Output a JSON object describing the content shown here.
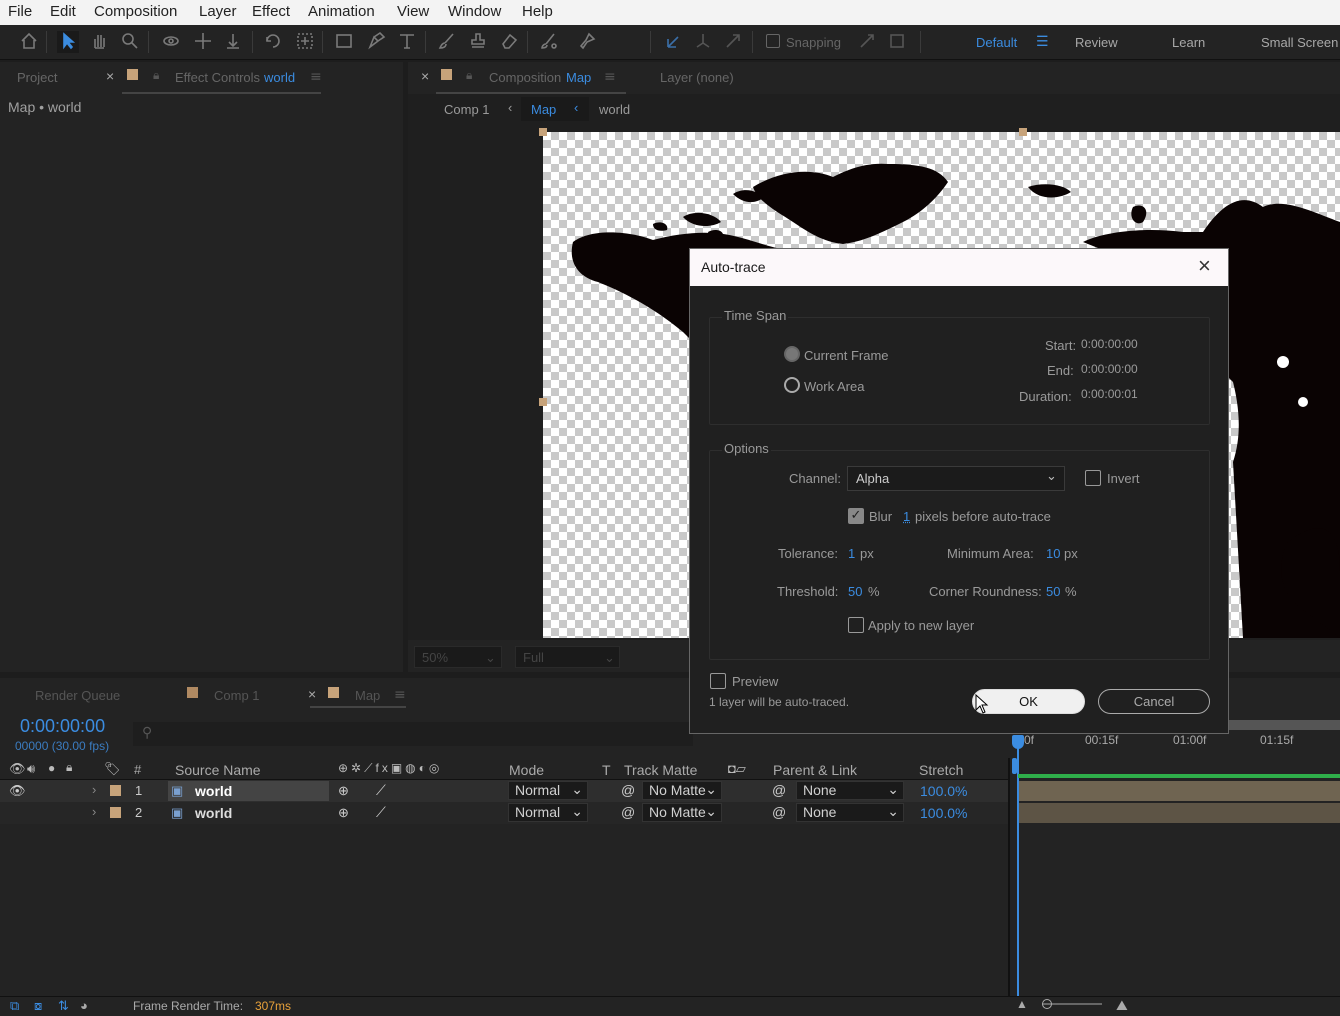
{
  "menu": [
    "File",
    "Edit",
    "Composition",
    "Layer",
    "Effect",
    "Animation",
    "View",
    "Window",
    "Help"
  ],
  "toolbar": {
    "snapping_label": "Snapping",
    "workspaces": [
      "Default",
      "Review",
      "Learn",
      "Small Screen"
    ]
  },
  "left_panel": {
    "tab_project": "Project",
    "tab_effect_controls": "Effect Controls",
    "effect_controls_target": "world",
    "breadcrumb": "Map • world"
  },
  "comp_panel": {
    "tab_label": "Composition",
    "tab_comp_name": "Map",
    "layer_tab": "Layer (none)",
    "crumbs": [
      "Comp 1",
      "Map",
      "world"
    ],
    "zoom": "50%",
    "resolution": "Full"
  },
  "dialog": {
    "title": "Auto-trace",
    "time_span_title": "Time Span",
    "current_frame": "Current Frame",
    "work_area": "Work Area",
    "start_label": "Start:",
    "start_value": "0:00:00:00",
    "end_label": "End:",
    "end_value": "0:00:00:00",
    "duration_label": "Duration:",
    "duration_value": "0:00:00:01",
    "options_title": "Options",
    "channel_label": "Channel:",
    "channel_value": "Alpha",
    "invert_label": "Invert",
    "blur_label": "Blur",
    "blur_value": "1",
    "blur_suffix": "pixels before auto-trace",
    "tolerance_label": "Tolerance:",
    "tolerance_value": "1",
    "tolerance_unit": "px",
    "min_area_label": "Minimum Area:",
    "min_area_value": "10",
    "min_area_unit": "px",
    "threshold_label": "Threshold:",
    "threshold_value": "50",
    "threshold_unit": "%",
    "corner_label": "Corner Roundness:",
    "corner_value": "50",
    "corner_unit": "%",
    "apply_new_layer": "Apply to new layer",
    "preview_label": "Preview",
    "status_text": "1 layer will be auto-traced.",
    "ok_label": "OK",
    "cancel_label": "Cancel"
  },
  "timeline": {
    "tab_render_queue": "Render Queue",
    "tab_comp1": "Comp 1",
    "tab_map": "Map",
    "timecode": "0:00:00:00",
    "frame_info": "00000 (30.00 fps)",
    "ruler": [
      "0f",
      "00:15f",
      "01:00f",
      "01:15f"
    ],
    "columns": {
      "num": "#",
      "source_name": "Source Name",
      "mode": "Mode",
      "t": "T",
      "track_matte": "Track Matte",
      "parent_link": "Parent & Link",
      "stretch": "Stretch"
    },
    "layers": [
      {
        "num": "1",
        "name": "world",
        "mode": "Normal",
        "matte": "No Matte",
        "parent": "None",
        "stretch": "100.0%"
      },
      {
        "num": "2",
        "name": "world",
        "mode": "Normal",
        "matte": "No Matte",
        "parent": "None",
        "stretch": "100.0%"
      }
    ]
  },
  "status_bar": {
    "render_time_label": "Frame Render Time:",
    "render_time_value": "307ms"
  },
  "colors": {
    "accent_blue": "#3b8ce0",
    "label_tan": "#c7a37a",
    "render_time_orange": "#e8a13a",
    "green_bar": "#2fae4a"
  }
}
